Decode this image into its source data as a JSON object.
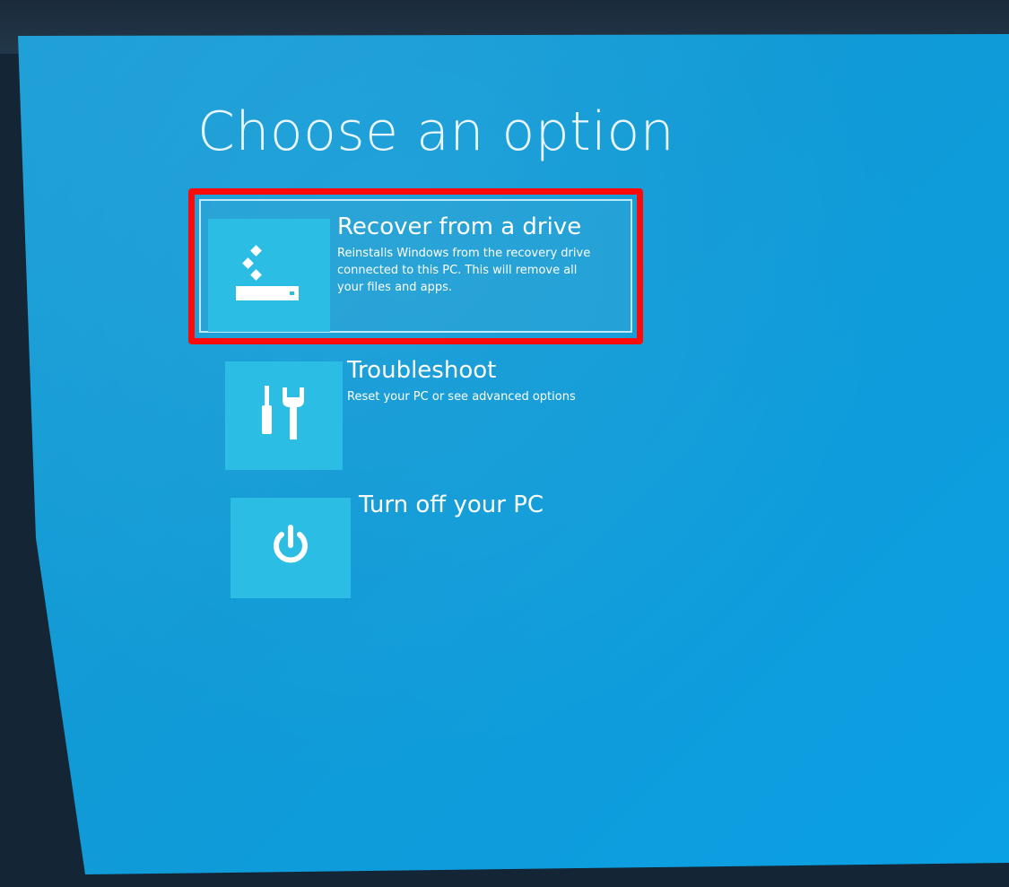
{
  "page": {
    "title": "Choose an option"
  },
  "options": [
    {
      "id": "recover",
      "title": "Recover from a drive",
      "description": "Reinstalls Windows from the recovery drive connected to this PC. This will remove all your files and apps.",
      "icon": "recovery-drive-icon"
    },
    {
      "id": "troubleshoot",
      "title": "Troubleshoot",
      "description": "Reset your PC or see advanced options",
      "icon": "tools-icon"
    },
    {
      "id": "turnoff",
      "title": "Turn off your PC",
      "description": "",
      "icon": "power-icon"
    }
  ],
  "colors": {
    "background": "#109ad6",
    "tile": "#2bbde3",
    "text": "#ffffff",
    "highlight": "#ff0a0a"
  }
}
